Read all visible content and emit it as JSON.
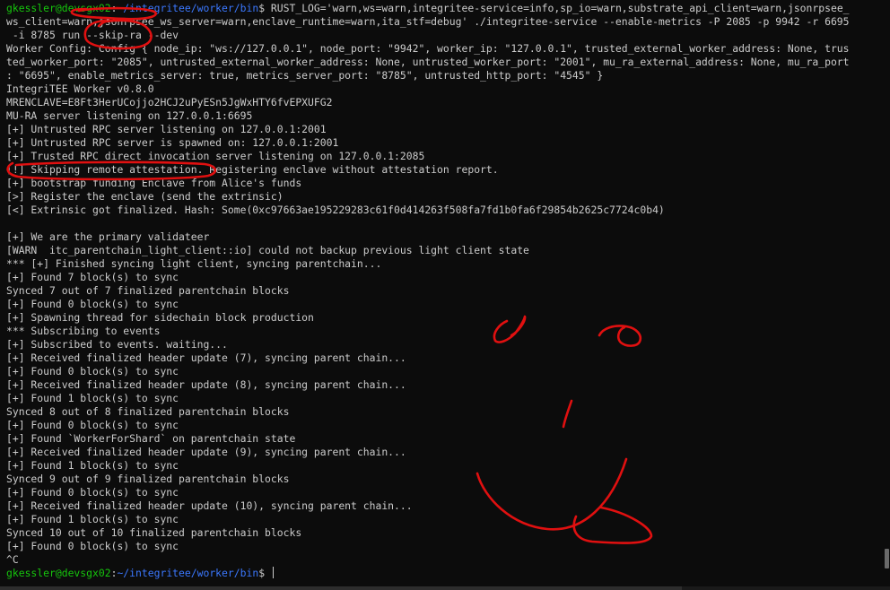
{
  "terminal": {
    "cmd_user": "gkessler@devsgx02",
    "cmd_sep": ":",
    "cmd_path": "~/integritee/worker/bin",
    "cmd_dollar": "$",
    "cmd_text": " RUST_LOG='warn,ws=warn,integritee-service=info,sp_io=warn,substrate_api_client=warn,jsonrpsee_",
    "cmd_cont_1": "ws_client=warn,jsonrpsee_ws_server=warn,enclave_runtime=warn,ita_stf=debug' ./integritee-service --enable-metrics -P 2085 -p 9942 -r 6695",
    "cmd_cont_2": " -i 8785 run --skip-ra --dev",
    "output": [
      "Worker Config: Config { node_ip: \"ws://127.0.0.1\", node_port: \"9942\", worker_ip: \"127.0.0.1\", trusted_external_worker_address: None, trus",
      "ted_worker_port: \"2085\", untrusted_external_worker_address: None, untrusted_worker_port: \"2001\", mu_ra_external_address: None, mu_ra_port",
      ": \"6695\", enable_metrics_server: true, metrics_server_port: \"8785\", untrusted_http_port: \"4545\" }",
      "IntegriTEE Worker v0.8.0",
      "MRENCLAVE=E8Ft3HerUCojjo2HCJ2uPyESn5JgWxHTY6fvEPXUFG2",
      "MU-RA server listening on 127.0.0.1:6695",
      "[+] Untrusted RPC server listening on 127.0.0.1:2001",
      "[+] Untrusted RPC server is spawned on: 127.0.0.1:2001",
      "[+] Trusted RPC direct invocation server listening on 127.0.0.1:2085",
      "[!] Skipping remote attestation. Registering enclave without attestation report.",
      "[+] bootstrap funding Enclave from Alice's funds",
      "[>] Register the enclave (send the extrinsic)",
      "[<] Extrinsic got finalized. Hash: Some(0xc97663ae195229283c61f0d414263f508fa7fd1b0fa6f29854b2625c7724c0b4)",
      "",
      "[+] We are the primary validateer",
      "[WARN  itc_parentchain_light_client::io] could not backup previous light client state",
      "*** [+] Finished syncing light client, syncing parentchain...",
      "[+] Found 7 block(s) to sync",
      "Synced 7 out of 7 finalized parentchain blocks",
      "[+] Found 0 block(s) to sync",
      "[+] Spawning thread for sidechain block production",
      "*** Subscribing to events",
      "[+] Subscribed to events. waiting...",
      "[+] Received finalized header update (7), syncing parent chain...",
      "[+] Found 0 block(s) to sync",
      "[+] Received finalized header update (8), syncing parent chain...",
      "[+] Found 1 block(s) to sync",
      "Synced 8 out of 8 finalized parentchain blocks",
      "[+] Found 0 block(s) to sync",
      "[+] Found `WorkerForShard` on parentchain state",
      "[+] Received finalized header update (9), syncing parent chain...",
      "[+] Found 1 block(s) to sync",
      "Synced 9 out of 9 finalized parentchain blocks",
      "[+] Found 0 block(s) to sync",
      "[+] Received finalized header update (10), syncing parent chain...",
      "[+] Found 1 block(s) to sync",
      "Synced 10 out of 10 finalized parentchain blocks",
      "[+] Found 0 block(s) to sync",
      "^C"
    ],
    "final_user": "gkessler@devsgx02",
    "final_sep": ":",
    "final_path": "~/integritee/worker/bin",
    "final_dollar": "$ "
  },
  "colors": {
    "background": "#0c0c0c",
    "text": "#cccccc",
    "prompt_user": "#16c60c",
    "prompt_path": "#3b78ff",
    "annotation_ink": "#e01010"
  }
}
